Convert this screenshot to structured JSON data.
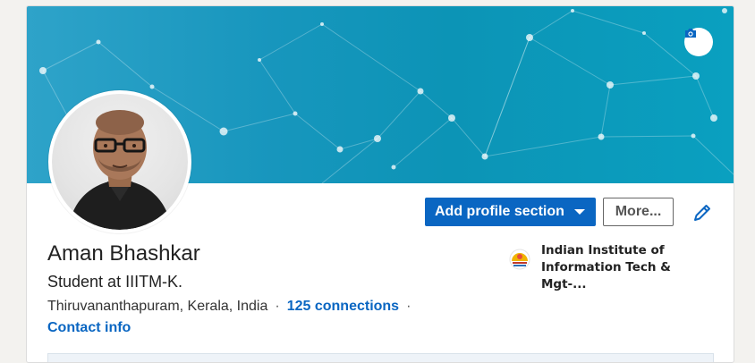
{
  "profile": {
    "name": "Aman Bhashkar",
    "headline": "Student at IIITM-K.",
    "location": "Thiruvananthapuram, Kerala, India",
    "separator": "·",
    "connections": "125 connections",
    "contact_info": "Contact info"
  },
  "actions": {
    "add_section_label": "Add profile section",
    "more_label": "More..."
  },
  "education": {
    "institution": "Indian Institute of Information Tech & Mgt-..."
  },
  "icons": {
    "banner_camera": "camera-icon",
    "edit": "pencil-icon",
    "dropdown": "caret-down-icon",
    "education_logo": "institution-logo"
  },
  "colors": {
    "accent": "#0a66c2",
    "banner": "#1796bd",
    "text": "#222222"
  }
}
